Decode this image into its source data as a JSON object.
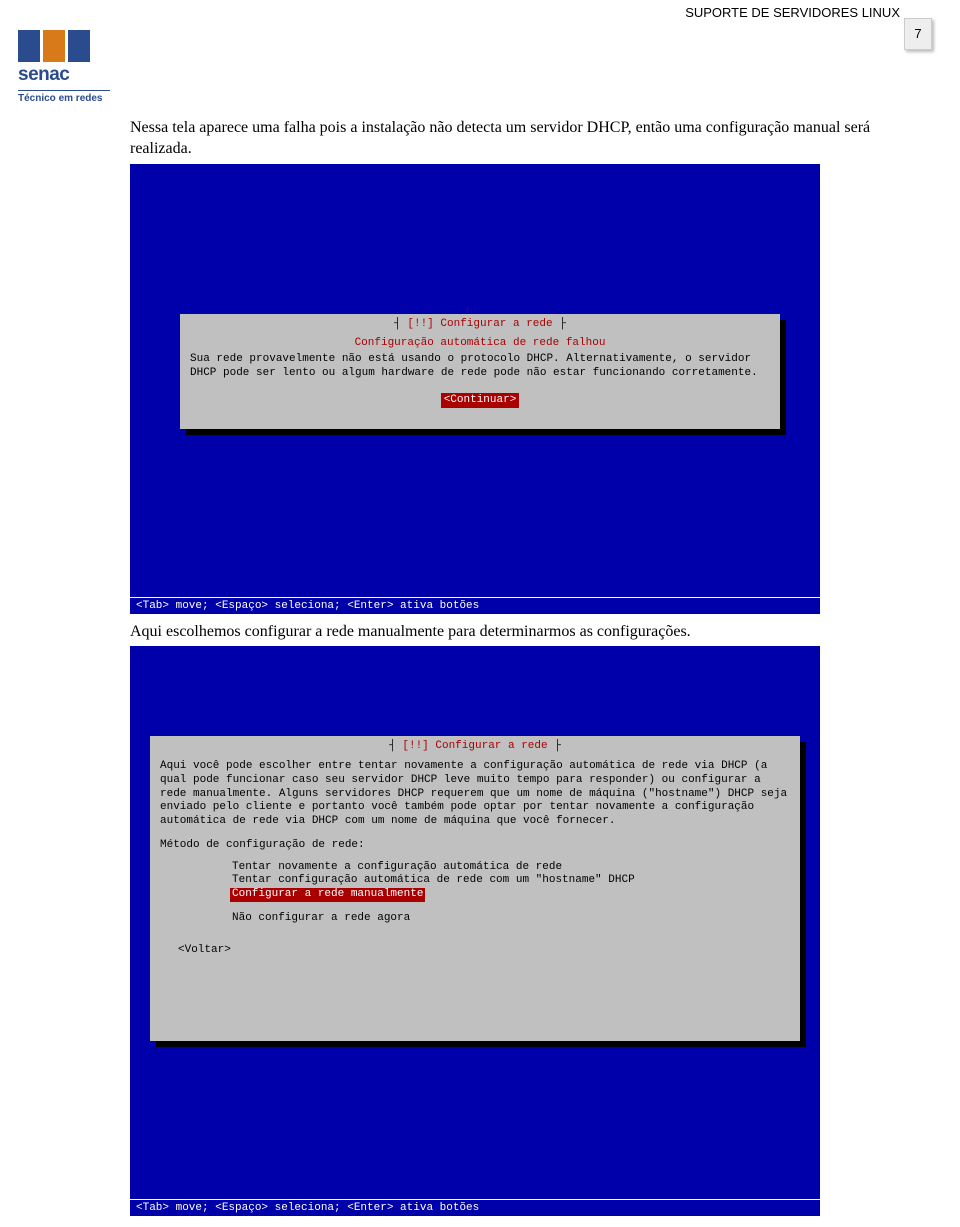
{
  "header": {
    "title": "SUPORTE DE SERVIDORES LINUX",
    "page_number": "7",
    "brand": "senac",
    "subtitle": "Técnico em redes"
  },
  "para1": "Nessa tela aparece uma falha pois a instalação não detecta um servidor DHCP, então uma configuração manual será realizada.",
  "screenshot1": {
    "title": "[!!] Configurar a rede",
    "subtitle": "Configuração automática de rede falhou",
    "body": "Sua rede provavelmente não está usando o protocolo DHCP. Alternativamente, o servidor DHCP pode ser lento ou algum hardware de rede pode não estar funcionando corretamente.",
    "continue": "<Continuar>",
    "statusbar": "<Tab> move; <Espaço> seleciona; <Enter> ativa botões"
  },
  "para2": "Aqui escolhemos configurar a rede manualmente para determinarmos as configurações.",
  "screenshot2": {
    "title": "[!!] Configurar a rede",
    "body": "Aqui você pode escolher entre tentar novamente a configuração automática de rede via DHCP (a qual pode funcionar caso seu servidor DHCP leve muito tempo para responder) ou configurar a rede manualmente. Alguns servidores DHCP requerem que um nome de máquina (\"hostname\") DHCP seja enviado pelo cliente e portanto você também pode optar por tentar novamente a configuração automática de rede via DHCP com um nome de máquina que você fornecer.",
    "prompt": "Método de configuração de rede:",
    "options": {
      "opt1": "Tentar novamente a configuração automática de rede",
      "opt2": "Tentar configuração automática de rede com um \"hostname\" DHCP",
      "opt3": "Configurar a rede manualmente",
      "opt4": "Não configurar a rede agora"
    },
    "back": "<Voltar>",
    "statusbar": "<Tab> move; <Espaço> seleciona; <Enter> ativa botões"
  }
}
